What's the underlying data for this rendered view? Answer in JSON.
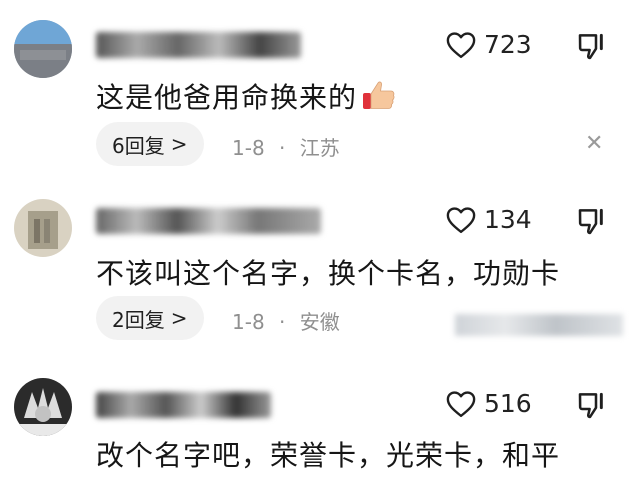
{
  "comments": [
    {
      "text": "这是他爸用命换来的",
      "likes": "723",
      "reply_label": "6回复",
      "date": "1-8",
      "sep": "·",
      "location": "江苏"
    },
    {
      "text": "不该叫这个名字，换个卡名，功勋卡",
      "likes": "134",
      "reply_label": "2回复",
      "date": "1-8",
      "sep": "·",
      "location": "安徽"
    },
    {
      "text": "改个名字吧，荣誉卡，光荣卡，和平",
      "likes": "516"
    }
  ],
  "icons": {
    "like": "heart-outline-icon",
    "dislike": "thumb-down-icon",
    "close": "close-icon",
    "chevron": "chevron-right-icon",
    "emoji": "thumbs-up-emoji"
  },
  "ui": {
    "chevron_glyph": ">",
    "close_glyph": "✕"
  },
  "colors": {
    "meta": "#8f8f8f",
    "pill_bg": "#f2f2f2",
    "text": "#161616"
  }
}
